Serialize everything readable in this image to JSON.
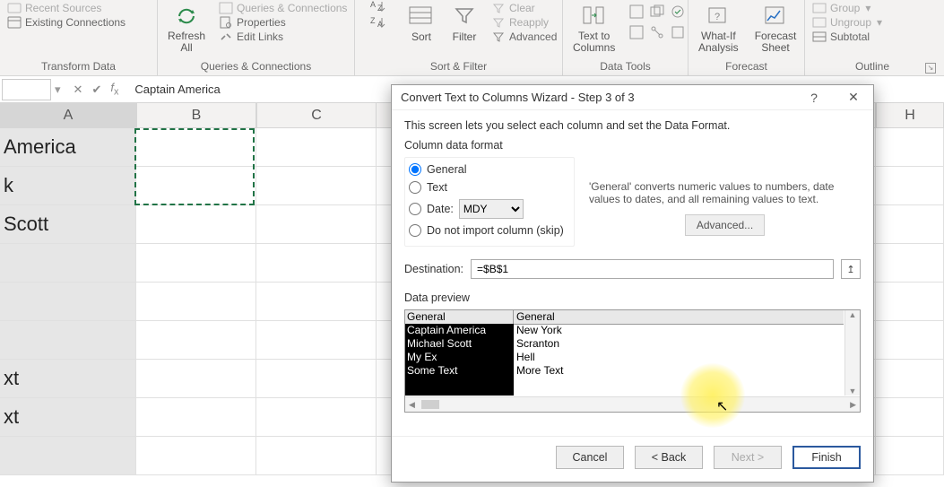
{
  "ribbon": {
    "groups": {
      "get_transform": {
        "label": "Transform Data",
        "recent_sources": "Recent Sources",
        "existing_connections": "Existing Connections"
      },
      "queries": {
        "label": "Queries & Connections",
        "refresh_all": "Refresh\nAll",
        "queries_connections": "Queries & Connections",
        "properties": "Properties",
        "edit_links": "Edit Links"
      },
      "sort_filter": {
        "label": "Sort & Filter",
        "sort": "Sort",
        "filter": "Filter",
        "clear": "Clear",
        "reapply": "Reapply",
        "advanced": "Advanced"
      },
      "data_tools": {
        "label": "Data Tools",
        "text_to_columns": "Text to\nColumns"
      },
      "forecast": {
        "label": "Forecast",
        "what_if": "What-If\nAnalysis",
        "forecast_sheet": "Forecast\nSheet"
      },
      "outline": {
        "label": "Outline",
        "group": "Group",
        "ungroup": "Ungroup",
        "subtotal": "Subtotal"
      }
    }
  },
  "formula_bar": {
    "cell_ref": "",
    "value": "Captain America"
  },
  "grid": {
    "columns": [
      "A",
      "B",
      "C",
      "H"
    ],
    "cells": {
      "A1": "America",
      "A2": "k",
      "A3": "Scott",
      "A4": "",
      "A5": "",
      "A6": "",
      "A7": "xt",
      "A8": "xt"
    }
  },
  "dialog": {
    "title": "Convert Text to Columns Wizard - Step 3 of 3",
    "intro": "This screen lets you select each column and set the Data Format.",
    "column_data_format_label": "Column data format",
    "radios": {
      "general": "General",
      "text": "Text",
      "date_label": "Date:",
      "date_value": "MDY",
      "skip": "Do not import column (skip)"
    },
    "general_desc": "'General' converts numeric values to numbers, date values to dates, and all remaining values to text.",
    "advanced_label": "Advanced...",
    "destination_label": "Destination:",
    "destination_value": "=$B$1",
    "preview_label": "Data preview",
    "preview": {
      "headers": [
        "General",
        "General"
      ],
      "rows": [
        [
          "Captain America",
          "New York"
        ],
        [
          "Michael Scott",
          "Scranton"
        ],
        [
          "My Ex",
          "Hell"
        ],
        [
          "Some Text",
          "More Text"
        ]
      ]
    },
    "buttons": {
      "cancel": "Cancel",
      "back": "< Back",
      "next": "Next >",
      "finish": "Finish"
    }
  }
}
